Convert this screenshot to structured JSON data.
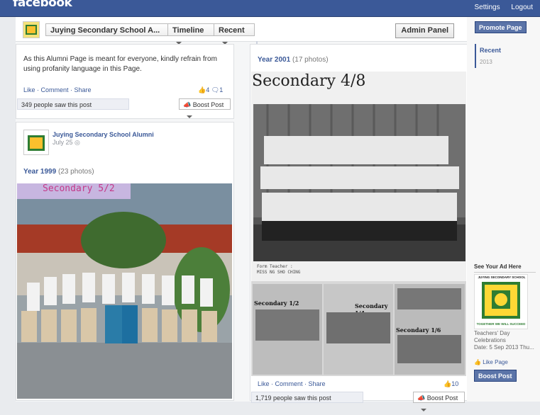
{
  "topbar": {
    "logo": "facebook",
    "settings": "Settings",
    "logout": "Logout"
  },
  "pagebar": {
    "page_name": "Juying Secondary School A...",
    "timeline": "Timeline",
    "recent": "Recent",
    "admin_panel": "Admin Panel"
  },
  "post1": {
    "text": "As this Alumni Page is meant for everyone, kindly refrain from using profanity language in this Page.",
    "like": "Like",
    "comment": "Comment",
    "share": "Share",
    "likes_count": "4",
    "comments_count": "1",
    "seen": "349 people saw this post",
    "boost": "Boost Post"
  },
  "post2": {
    "author": "Juying Secondary School Alumni",
    "date": "July 25",
    "album_title": "Year 1999",
    "album_count": "(23 photos)",
    "photo_caption": "Secondary 5/2"
  },
  "post3": {
    "album_title": "Year 2001",
    "album_count": "(17 photos)",
    "main_title": "Secondary 4/8",
    "form_teacher_label": "Form Teacher :",
    "form_teacher_name": "MISS NG SHO CHING",
    "thumb_labels": [
      "Secondary 1/2",
      "Secondary 1/4",
      "Secondary 1/6"
    ],
    "like": "Like",
    "comment": "Comment",
    "share": "Share",
    "likes_count": "10",
    "seen": "1,719 people saw this post",
    "boost": "Boost Post"
  },
  "sidebar": {
    "promote": "Promote Page",
    "recent": "Recent",
    "year": "2013",
    "ad_title": "See Your Ad Here",
    "ad_school": "JUYING SECONDARY SCHOOL",
    "ad_motto": "TOGETHER WE WILL SUCCEED",
    "ad_text": "Teachers' Day Celebrations",
    "ad_date": "Date: 5 Sep 2013 Thu...",
    "like_page": "Like Page",
    "boost": "Boost Post"
  },
  "colors": {
    "fb_blue": "#3b5998",
    "accent": "#5b74a8"
  }
}
